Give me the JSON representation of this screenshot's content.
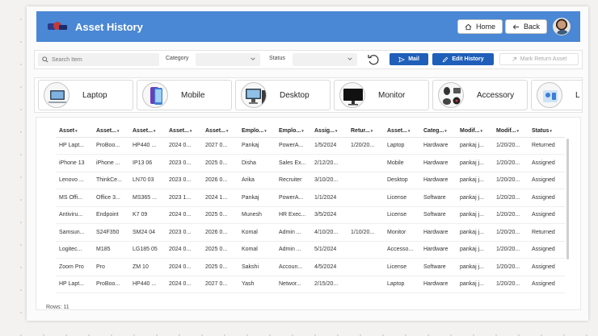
{
  "header": {
    "title": "Asset History",
    "home_label": "Home",
    "back_label": "Back"
  },
  "filters": {
    "search_placeholder": "Search Item",
    "category_label": "Category",
    "category_value": "",
    "status_label": "Status",
    "status_value": "",
    "mail_label": "Mail",
    "edit_history_label": "Edit History",
    "mark_return_label": "Mark Return Asset"
  },
  "categories": [
    {
      "label": "Laptop",
      "icon": "laptop-icon"
    },
    {
      "label": "Mobile",
      "icon": "mobile-icon"
    },
    {
      "label": "Desktop",
      "icon": "desktop-icon"
    },
    {
      "label": "Monitor",
      "icon": "monitor-icon"
    },
    {
      "label": "Accessory",
      "icon": "accessory-icon"
    },
    {
      "label": "L",
      "icon": "license-icon"
    }
  ],
  "table": {
    "columns": [
      "Asset",
      "Asset...",
      "Asset...",
      "Asset...",
      "Asset...",
      "Emplo...",
      "Emplo...",
      "Assig...",
      "Retur...",
      "Asset...",
      "Categ...",
      "Modif...",
      "Modif...",
      "Status"
    ],
    "rows": [
      [
        "HP Lapt...",
        "ProBoo...",
        "HP440 ...",
        "2024 0...",
        "2027 0...",
        "Pankaj",
        "PowerA...",
        "1/5/2024",
        "1/20/20...",
        "Laptop",
        "Hardware",
        "pankaj j...",
        "1/20/20...",
        "Returned"
      ],
      [
        "iPhone 13",
        "iPhone ...",
        "IP13 06",
        "2023 0...",
        "2025 0...",
        "Disha",
        "Sales Ex...",
        "2/12/20...",
        "",
        "Mobile",
        "Hardware",
        "pankaj j...",
        "1/20/20...",
        "Assigned"
      ],
      [
        "Lenovo ...",
        "ThinkCe...",
        "LN70 03",
        "2023 0...",
        "2026 0...",
        "Arika",
        "Recruiter",
        "3/10/20...",
        "",
        "Desktop",
        "Hardware",
        "pankaj j...",
        "1/20/20...",
        "Assigned"
      ],
      [
        "MS Offi...",
        "Office 3...",
        "MS365 ...",
        "2023 1...",
        "2024 1...",
        "Pankaj",
        "PowerA...",
        "1/1/2024",
        "",
        "License",
        "Software",
        "pankaj j...",
        "1/20/20...",
        "Assigned"
      ],
      [
        "Antiviru...",
        "Endpoint",
        "K7 09",
        "2024 0...",
        "2025 0...",
        "Munesh",
        "HR Exec...",
        "3/5/2024",
        "",
        "License",
        "Software",
        "pankaj j...",
        "1/20/20...",
        "Assigned"
      ],
      [
        "Samsun...",
        "S24F350",
        "SM24 04",
        "2023 0...",
        "2026 0...",
        "Komal",
        "Admin ...",
        "4/10/20...",
        "1/10/20...",
        "Monitor",
        "Hardware",
        "pankaj j...",
        "1/20/20...",
        "Returned"
      ],
      [
        "Logitec...",
        "M185",
        "LG185 05",
        "2024 0...",
        "2025 0...",
        "Komal",
        "Admin ...",
        "5/1/2024",
        "",
        "Accesso...",
        "Hardware",
        "pankaj j...",
        "1/20/20...",
        "Assigned"
      ],
      [
        "Zoom Pro",
        "Pro",
        "ZM 10",
        "2024 0...",
        "2025 0...",
        "Sakshi",
        "Accoun...",
        "4/5/2024",
        "",
        "License",
        "Software",
        "pankaj j...",
        "1/20/20...",
        "Assigned"
      ],
      [
        "HP Lapt...",
        "ProBoo...",
        "HP440 ...",
        "2024 0...",
        "2027 0...",
        "Yash",
        "Networ...",
        "2/15/20...",
        "",
        "Laptop",
        "Hardware",
        "pankaj j...",
        "1/20/20...",
        "Assigned"
      ]
    ],
    "rows_label": "Rows: 11"
  },
  "colors": {
    "header": "#4a87d4",
    "primary_button": "#1f5fb9"
  }
}
